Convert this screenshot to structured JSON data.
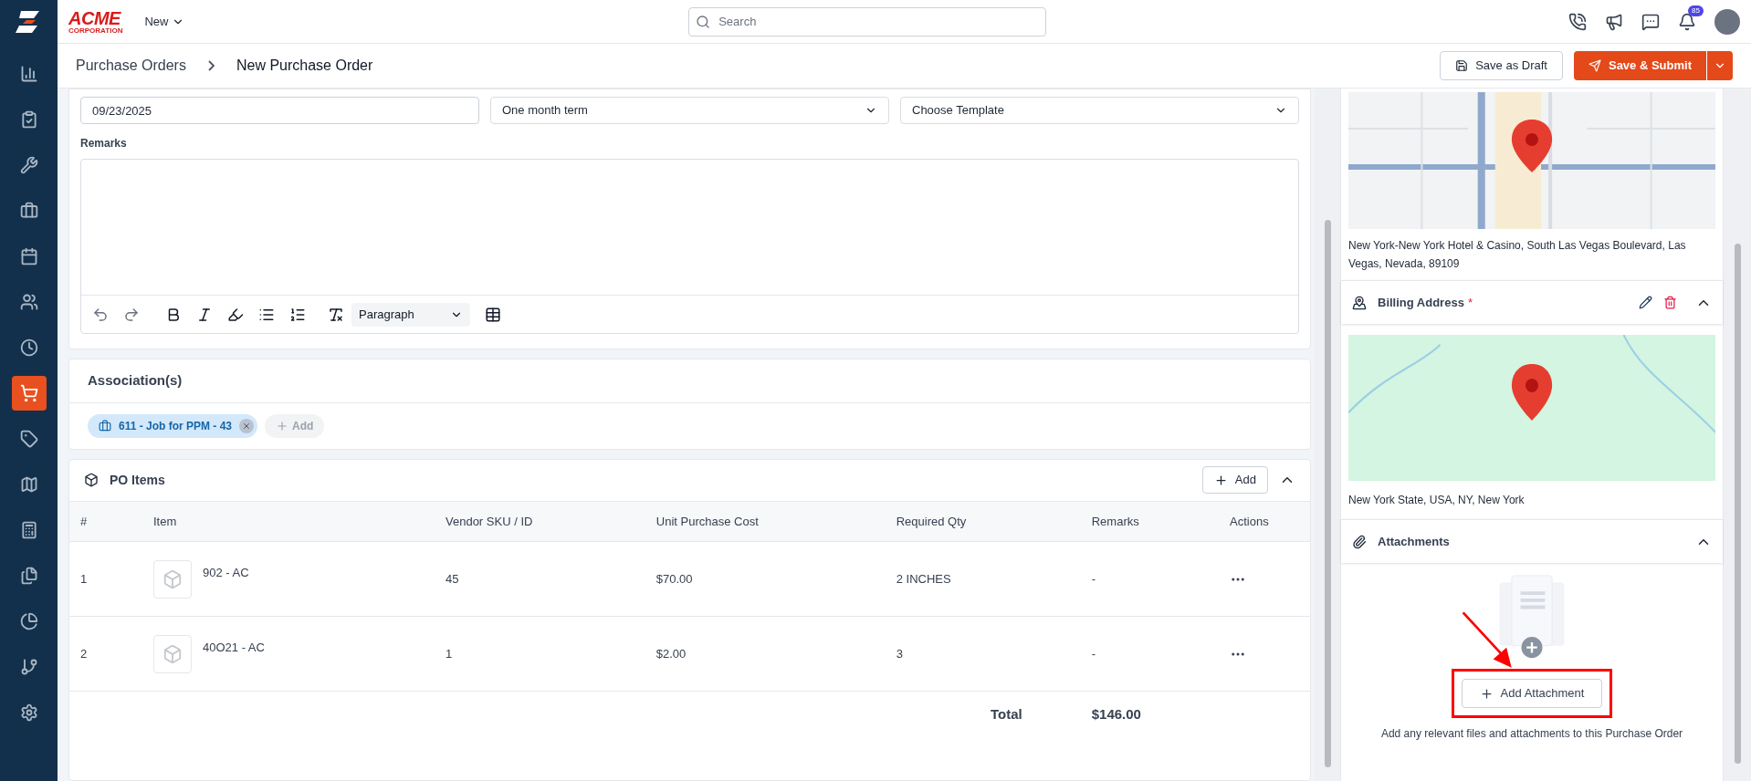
{
  "app": {
    "logo_text": "ACME",
    "logo_subtext": "CORPORATION",
    "new_menu": "New",
    "search": {
      "placeholder": "Search"
    },
    "notification_count": "85"
  },
  "sidebar": {
    "items": [
      {
        "kind": "chart",
        "selected": false
      },
      {
        "kind": "clipboard",
        "selected": false
      },
      {
        "kind": "tools",
        "selected": false
      },
      {
        "kind": "briefcase",
        "selected": false
      },
      {
        "kind": "calendar",
        "selected": false
      },
      {
        "kind": "users",
        "selected": false
      },
      {
        "kind": "clock",
        "selected": false
      },
      {
        "kind": "cart",
        "selected": true
      },
      {
        "kind": "tag",
        "selected": false
      },
      {
        "kind": "map",
        "selected": false
      },
      {
        "kind": "calculator",
        "selected": false
      },
      {
        "kind": "files",
        "selected": false
      },
      {
        "kind": "pie",
        "selected": false
      },
      {
        "kind": "branch",
        "selected": false
      },
      {
        "kind": "settings",
        "selected": false
      }
    ]
  },
  "breadcrumb": [
    "Purchase Orders",
    "New Purchase Order"
  ],
  "actions": {
    "draft": "Save as Draft",
    "submit": "Save & Submit"
  },
  "form": {
    "date": "09/23/2025",
    "term": "One month term",
    "template": "Choose Template",
    "remarks_label": "Remarks",
    "format": "Paragraph"
  },
  "associations": {
    "title": "Association(s)",
    "tags": [
      "611 - Job for PPM - 43"
    ],
    "add": "Add"
  },
  "po_items": {
    "title": "PO Items",
    "add": "Add",
    "columns": [
      "#",
      "Item",
      "Vendor SKU / ID",
      "Unit Purchase Cost",
      "Required Qty",
      "Remarks",
      "Actions"
    ],
    "rows": [
      {
        "no": "1",
        "item": "902 - AC",
        "sku": "45",
        "cost": "$70.00",
        "qty": "2 INCHES",
        "remarks": "-"
      },
      {
        "no": "2",
        "item": "40O21 - AC",
        "sku": "1",
        "cost": "$2.00",
        "qty": "3",
        "remarks": "-"
      }
    ],
    "total_label": "Total",
    "total": "$146.00"
  },
  "right_panel": {
    "shipping_address": "New York-New York Hotel & Casino, South Las Vegas Boulevard, Las Vegas, Nevada, 89109",
    "billing": {
      "title": "Billing Address",
      "required_mark": "*",
      "address": "New York State, USA, NY, New York"
    },
    "attachments": {
      "title": "Attachments",
      "button": "Add Attachment",
      "hint": "Add any relevant files and attachments to this Purchase Order"
    }
  }
}
